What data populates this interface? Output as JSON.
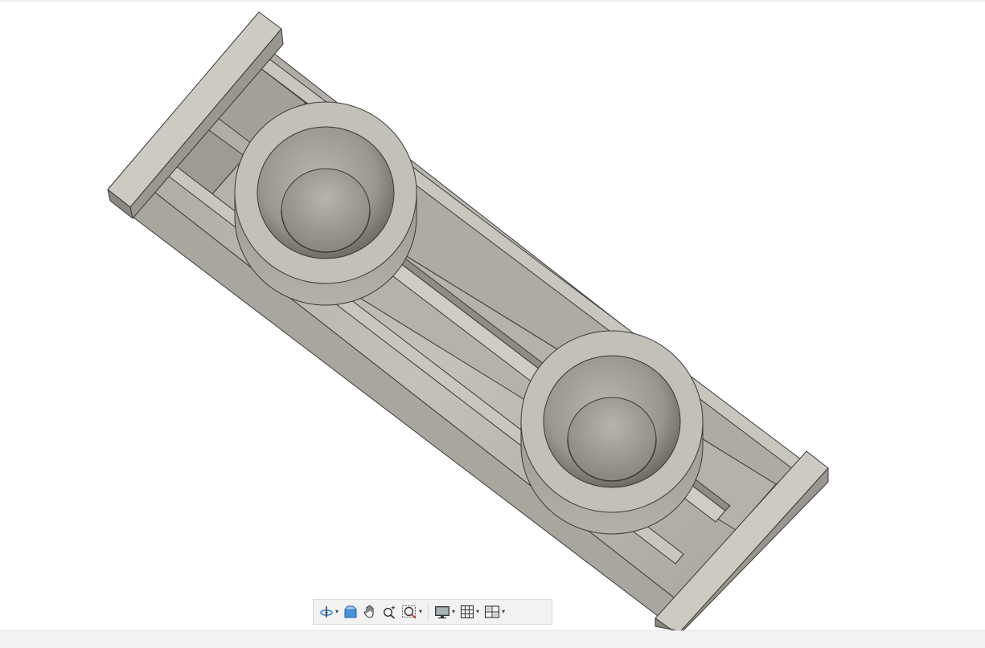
{
  "viewport": {
    "background": "#ffffff",
    "model_colors": {
      "body": "#bdbab1",
      "light_face": "#d6d3cb",
      "dark_face": "#8f8c84",
      "edge": "#3a3a38"
    }
  },
  "toolbar": {
    "items": [
      {
        "icon": "orbit-icon",
        "has_dropdown": true
      },
      {
        "icon": "look-at-icon",
        "has_dropdown": false
      },
      {
        "icon": "pan-hand-icon",
        "has_dropdown": false
      },
      {
        "icon": "zoom-icon",
        "has_dropdown": false
      },
      {
        "icon": "fit-window-icon",
        "has_dropdown": true
      },
      {
        "icon": "display-settings-icon",
        "has_dropdown": true
      },
      {
        "icon": "grid-settings-icon",
        "has_dropdown": true
      },
      {
        "icon": "viewports-icon",
        "has_dropdown": true
      }
    ],
    "caret_glyph": "▾",
    "accent_color": "#2a7bd4"
  }
}
